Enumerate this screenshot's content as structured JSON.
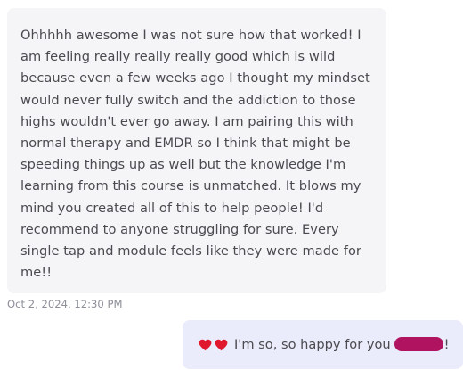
{
  "messages": {
    "incoming": {
      "text": "Ohhhhh awesome I was not sure how that worked! I am feeling really really really good which is wild because even a few weeks ago I thought my mindset would never fully switch and the addiction to those highs wouldn't ever go away. I am pairing this with normal therapy and EMDR so I think that might be speeding things up as well but the knowledge I'm learning from this course is unmatched. It blows my mind you created all of this to help people! I'd recommend to anyone struggling for sure. Every single tap and module feels like they were made for me!!",
      "timestamp": "Oct 2, 2024, 12:30 PM"
    },
    "outgoing": {
      "text": "I'm so, so happy for you",
      "tail": "!",
      "heart_color": "#e0182d",
      "redaction_color": "#b0135f"
    }
  }
}
